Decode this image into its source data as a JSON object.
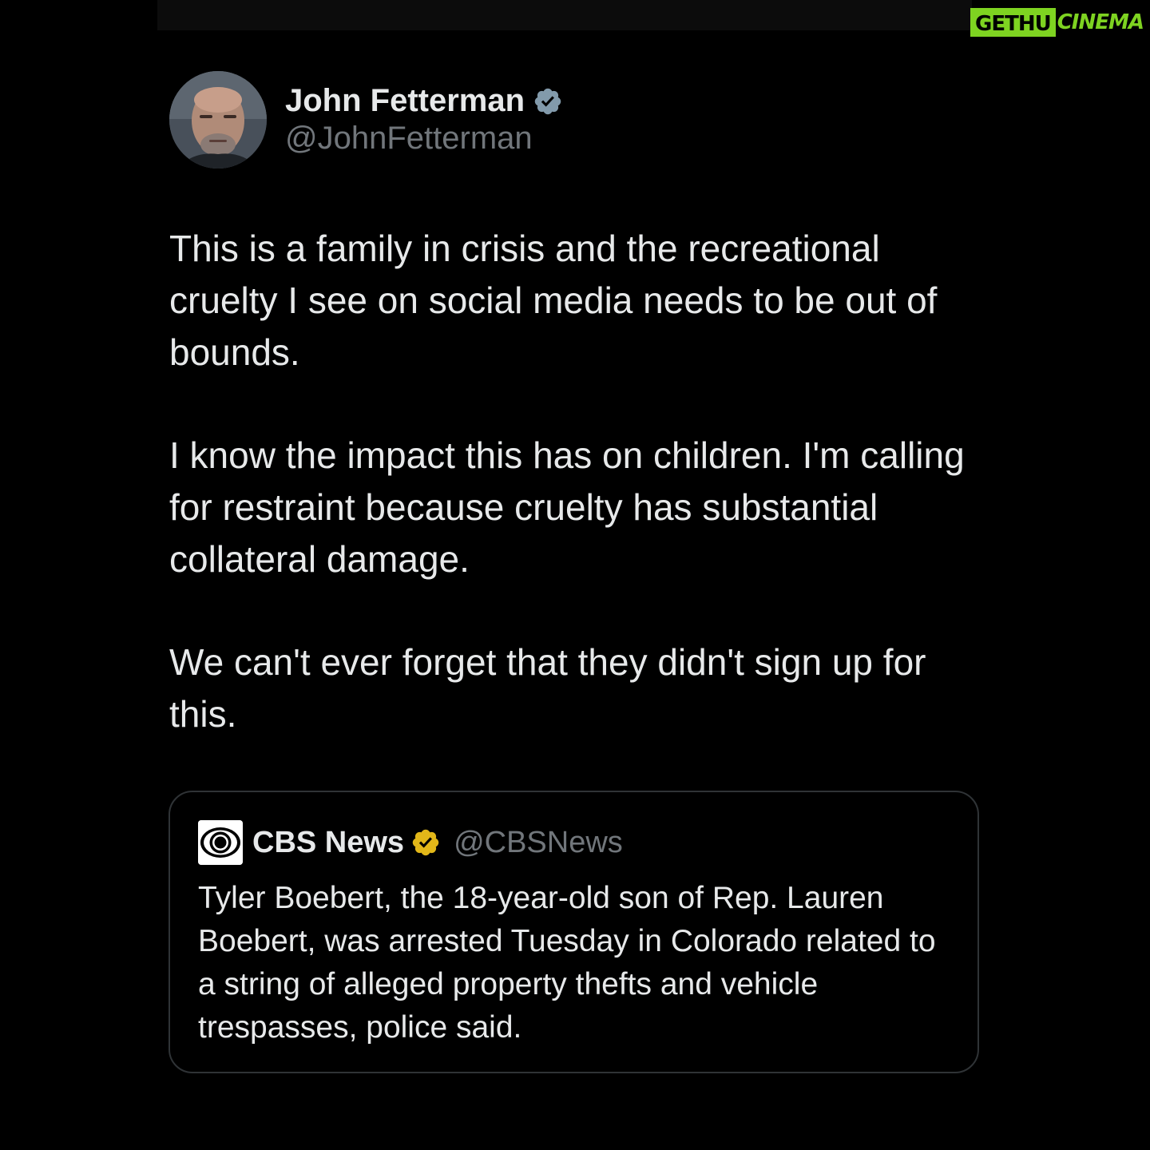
{
  "watermark": {
    "brand_box": "GETHU",
    "brand_rest": "CINEMA",
    "color": "#7ed321"
  },
  "tweet": {
    "author": {
      "display_name": "John Fetterman",
      "handle": "@JohnFetterman",
      "verified_icon": "verified-badge-icon",
      "verified_color": "#829aab"
    },
    "paragraphs": [
      "This is a family in crisis and the recreational cruelty I see on social media needs to be out of bounds.",
      "I know the impact this has on children. I'm calling for restraint because cruelty has substantial collateral damage.",
      "We can't ever forget that they didn't sign up for this."
    ]
  },
  "quoted_tweet": {
    "author": {
      "display_name": "CBS News",
      "handle": "@CBSNews",
      "logo_icon": "cbs-eye-logo-icon",
      "verified_icon": "gold-verified-badge-icon",
      "verified_color": "#e2b719"
    },
    "text": "Tyler Boebert, the 18-year-old son of Rep. Lauren Boebert, was arrested Tuesday in Colorado related to a string of alleged property thefts and vehicle trespasses, police said."
  },
  "colors": {
    "background": "#000000",
    "text_primary": "#e7e9ea",
    "text_secondary": "#71767b",
    "border": "#2f3336"
  }
}
